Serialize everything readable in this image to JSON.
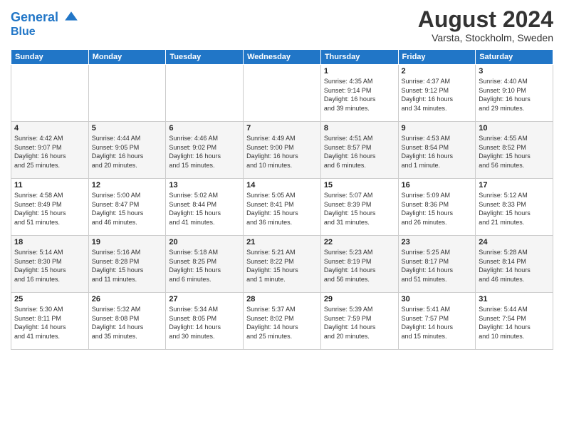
{
  "header": {
    "logo_line1": "General",
    "logo_line2": "Blue",
    "month_year": "August 2024",
    "location": "Varsta, Stockholm, Sweden"
  },
  "days_of_week": [
    "Sunday",
    "Monday",
    "Tuesday",
    "Wednesday",
    "Thursday",
    "Friday",
    "Saturday"
  ],
  "weeks": [
    [
      {
        "day": "",
        "info": ""
      },
      {
        "day": "",
        "info": ""
      },
      {
        "day": "",
        "info": ""
      },
      {
        "day": "",
        "info": ""
      },
      {
        "day": "1",
        "info": "Sunrise: 4:35 AM\nSunset: 9:14 PM\nDaylight: 16 hours\nand 39 minutes."
      },
      {
        "day": "2",
        "info": "Sunrise: 4:37 AM\nSunset: 9:12 PM\nDaylight: 16 hours\nand 34 minutes."
      },
      {
        "day": "3",
        "info": "Sunrise: 4:40 AM\nSunset: 9:10 PM\nDaylight: 16 hours\nand 29 minutes."
      }
    ],
    [
      {
        "day": "4",
        "info": "Sunrise: 4:42 AM\nSunset: 9:07 PM\nDaylight: 16 hours\nand 25 minutes."
      },
      {
        "day": "5",
        "info": "Sunrise: 4:44 AM\nSunset: 9:05 PM\nDaylight: 16 hours\nand 20 minutes."
      },
      {
        "day": "6",
        "info": "Sunrise: 4:46 AM\nSunset: 9:02 PM\nDaylight: 16 hours\nand 15 minutes."
      },
      {
        "day": "7",
        "info": "Sunrise: 4:49 AM\nSunset: 9:00 PM\nDaylight: 16 hours\nand 10 minutes."
      },
      {
        "day": "8",
        "info": "Sunrise: 4:51 AM\nSunset: 8:57 PM\nDaylight: 16 hours\nand 6 minutes."
      },
      {
        "day": "9",
        "info": "Sunrise: 4:53 AM\nSunset: 8:54 PM\nDaylight: 16 hours\nand 1 minute."
      },
      {
        "day": "10",
        "info": "Sunrise: 4:55 AM\nSunset: 8:52 PM\nDaylight: 15 hours\nand 56 minutes."
      }
    ],
    [
      {
        "day": "11",
        "info": "Sunrise: 4:58 AM\nSunset: 8:49 PM\nDaylight: 15 hours\nand 51 minutes."
      },
      {
        "day": "12",
        "info": "Sunrise: 5:00 AM\nSunset: 8:47 PM\nDaylight: 15 hours\nand 46 minutes."
      },
      {
        "day": "13",
        "info": "Sunrise: 5:02 AM\nSunset: 8:44 PM\nDaylight: 15 hours\nand 41 minutes."
      },
      {
        "day": "14",
        "info": "Sunrise: 5:05 AM\nSunset: 8:41 PM\nDaylight: 15 hours\nand 36 minutes."
      },
      {
        "day": "15",
        "info": "Sunrise: 5:07 AM\nSunset: 8:39 PM\nDaylight: 15 hours\nand 31 minutes."
      },
      {
        "day": "16",
        "info": "Sunrise: 5:09 AM\nSunset: 8:36 PM\nDaylight: 15 hours\nand 26 minutes."
      },
      {
        "day": "17",
        "info": "Sunrise: 5:12 AM\nSunset: 8:33 PM\nDaylight: 15 hours\nand 21 minutes."
      }
    ],
    [
      {
        "day": "18",
        "info": "Sunrise: 5:14 AM\nSunset: 8:30 PM\nDaylight: 15 hours\nand 16 minutes."
      },
      {
        "day": "19",
        "info": "Sunrise: 5:16 AM\nSunset: 8:28 PM\nDaylight: 15 hours\nand 11 minutes."
      },
      {
        "day": "20",
        "info": "Sunrise: 5:18 AM\nSunset: 8:25 PM\nDaylight: 15 hours\nand 6 minutes."
      },
      {
        "day": "21",
        "info": "Sunrise: 5:21 AM\nSunset: 8:22 PM\nDaylight: 15 hours\nand 1 minute."
      },
      {
        "day": "22",
        "info": "Sunrise: 5:23 AM\nSunset: 8:19 PM\nDaylight: 14 hours\nand 56 minutes."
      },
      {
        "day": "23",
        "info": "Sunrise: 5:25 AM\nSunset: 8:17 PM\nDaylight: 14 hours\nand 51 minutes."
      },
      {
        "day": "24",
        "info": "Sunrise: 5:28 AM\nSunset: 8:14 PM\nDaylight: 14 hours\nand 46 minutes."
      }
    ],
    [
      {
        "day": "25",
        "info": "Sunrise: 5:30 AM\nSunset: 8:11 PM\nDaylight: 14 hours\nand 41 minutes."
      },
      {
        "day": "26",
        "info": "Sunrise: 5:32 AM\nSunset: 8:08 PM\nDaylight: 14 hours\nand 35 minutes."
      },
      {
        "day": "27",
        "info": "Sunrise: 5:34 AM\nSunset: 8:05 PM\nDaylight: 14 hours\nand 30 minutes."
      },
      {
        "day": "28",
        "info": "Sunrise: 5:37 AM\nSunset: 8:02 PM\nDaylight: 14 hours\nand 25 minutes."
      },
      {
        "day": "29",
        "info": "Sunrise: 5:39 AM\nSunset: 7:59 PM\nDaylight: 14 hours\nand 20 minutes."
      },
      {
        "day": "30",
        "info": "Sunrise: 5:41 AM\nSunset: 7:57 PM\nDaylight: 14 hours\nand 15 minutes."
      },
      {
        "day": "31",
        "info": "Sunrise: 5:44 AM\nSunset: 7:54 PM\nDaylight: 14 hours\nand 10 minutes."
      }
    ]
  ]
}
